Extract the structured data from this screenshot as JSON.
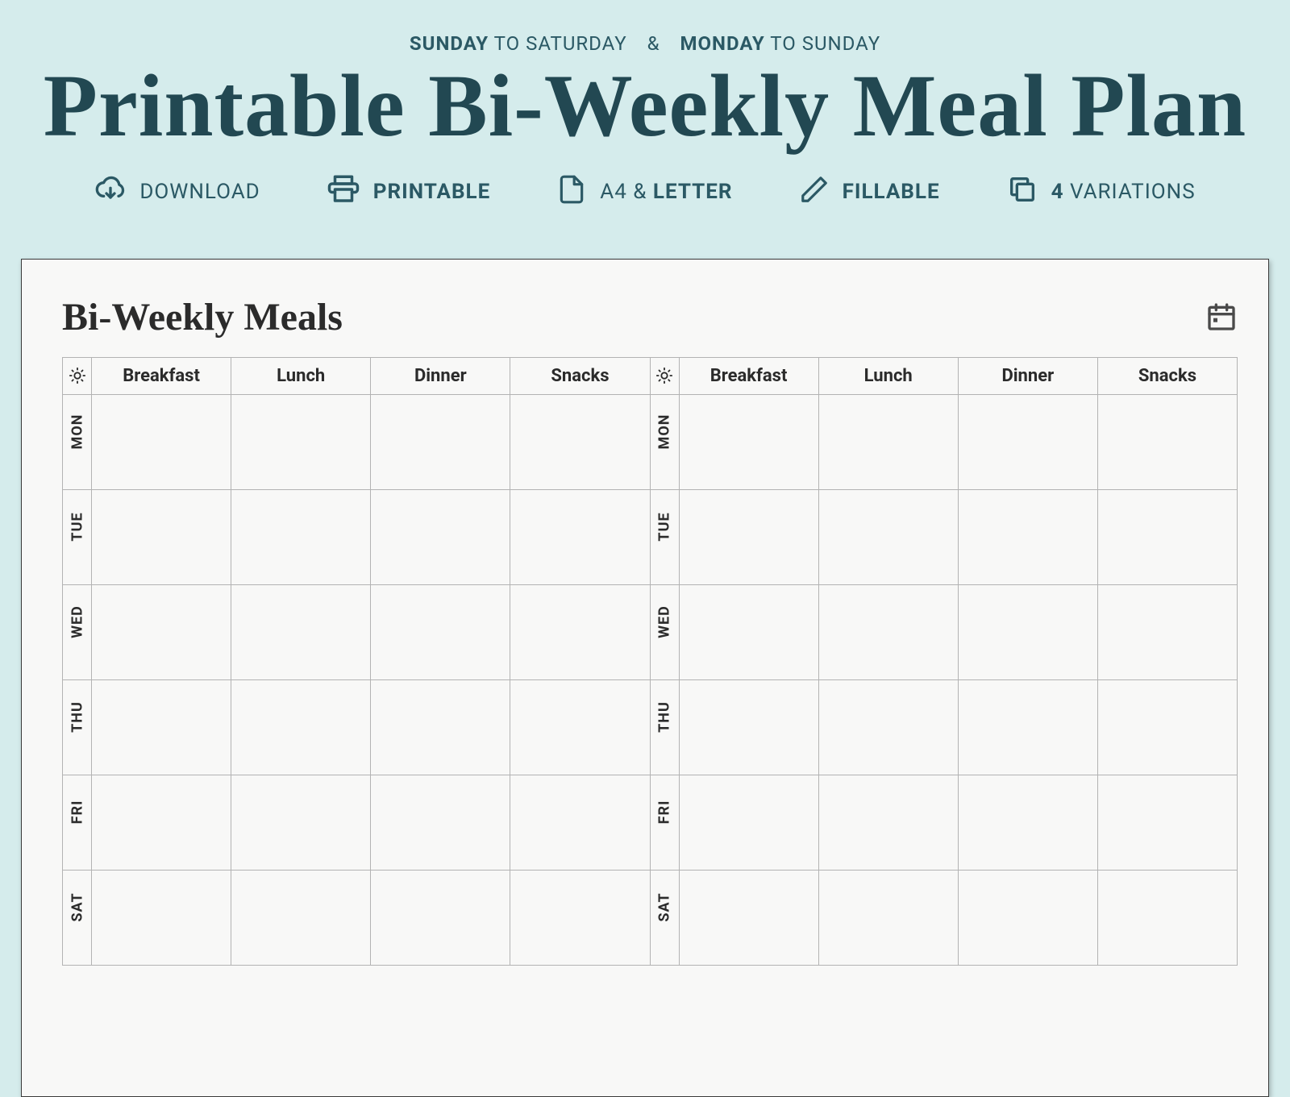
{
  "tagline": {
    "sunday": "SUNDAY",
    "to1": "TO SATURDAY",
    "amp": "&",
    "monday": "MONDAY",
    "to2": "TO SUNDAY"
  },
  "hero_title": "Printable Bi-Weekly Meal Plan",
  "features": {
    "download": "DOWNLOAD",
    "printable": "PRINTABLE",
    "a4_pre": "A4 &",
    "letter": "LETTER",
    "fillable": "FILLABLE",
    "var_num": "4",
    "var_txt": "VARIATIONS"
  },
  "sheet": {
    "title": "Bi-Weekly Meals",
    "columns": {
      "breakfast": "Breakfast",
      "lunch": "Lunch",
      "dinner": "Dinner",
      "snacks": "Snacks"
    },
    "days": {
      "mon": "MON",
      "tue": "TUE",
      "wed": "WED",
      "thu": "THU",
      "fri": "FRI",
      "sat": "SAT"
    }
  }
}
